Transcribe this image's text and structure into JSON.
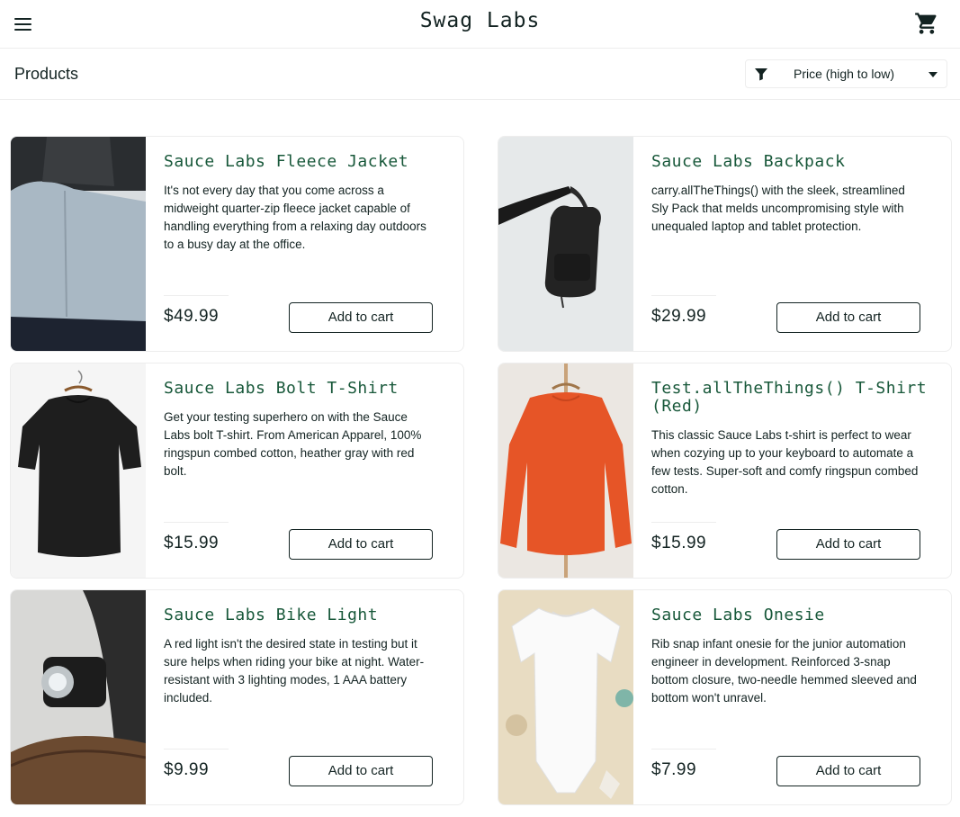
{
  "header": {
    "logo": "Swag Labs",
    "menu_icon": "hamburger-menu-icon",
    "cart_icon": "shopping-cart-icon"
  },
  "sub_header": {
    "title": "Products",
    "sort": {
      "selected": "Price (high to low)",
      "icon": "filter-icon"
    }
  },
  "colors": {
    "accent": "#18583a",
    "text": "#132322",
    "border": "#ededed"
  },
  "items": [
    {
      "name": "Sauce Labs Fleece Jacket",
      "desc": "It's not every day that you come across a midweight quarter-zip fleece jacket capable of handling everything from a relaxing day outdoors to a busy day at the office.",
      "price": "$49.99",
      "button": "Add to cart",
      "image": "fleece-jacket-photo"
    },
    {
      "name": "Sauce Labs Backpack",
      "desc": "carry.allTheThings() with the sleek, streamlined Sly Pack that melds uncompromising style with unequaled laptop and tablet protection.",
      "price": "$29.99",
      "button": "Add to cart",
      "image": "backpack-photo"
    },
    {
      "name": "Sauce Labs Bolt T-Shirt",
      "desc": "Get your testing superhero on with the Sauce Labs bolt T-shirt. From American Apparel, 100% ringspun combed cotton, heather gray with red bolt.",
      "price": "$15.99",
      "button": "Add to cart",
      "image": "black-tshirt-photo"
    },
    {
      "name": "Test.allTheThings() T-Shirt (Red)",
      "desc": "This classic Sauce Labs t-shirt is perfect to wear when cozying up to your keyboard to automate a few tests. Super-soft and comfy ringspun combed cotton.",
      "price": "$15.99",
      "button": "Add to cart",
      "image": "red-sweater-photo"
    },
    {
      "name": "Sauce Labs Bike Light",
      "desc": "A red light isn't the desired state in testing but it sure helps when riding your bike at night. Water-resistant with 3 lighting modes, 1 AAA battery included.",
      "price": "$9.99",
      "button": "Add to cart",
      "image": "bike-light-photo"
    },
    {
      "name": "Sauce Labs Onesie",
      "desc": "Rib snap infant onesie for the junior automation engineer in development. Reinforced 3-snap bottom closure, two-needle hemmed sleeved and bottom won't unravel.",
      "price": "$7.99",
      "button": "Add to cart",
      "image": "onesie-photo"
    }
  ]
}
